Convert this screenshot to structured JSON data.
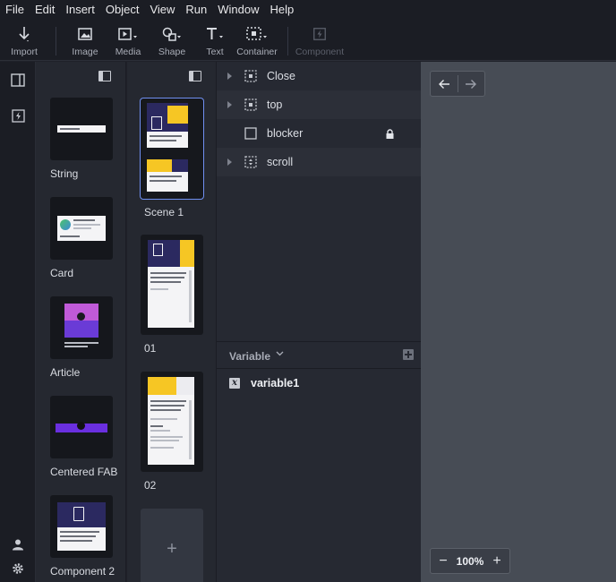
{
  "menu": [
    "File",
    "Edit",
    "Insert",
    "Object",
    "View",
    "Run",
    "Window",
    "Help"
  ],
  "toolbar": {
    "import": "Import",
    "image": "Image",
    "media": "Media",
    "shape": "Shape",
    "text": "Text",
    "container": "Container",
    "component": "Component"
  },
  "components": [
    {
      "name": "String"
    },
    {
      "name": "Card"
    },
    {
      "name": "Article"
    },
    {
      "name": "Centered FAB"
    },
    {
      "name": "Component 2"
    }
  ],
  "scenes": [
    {
      "name": "Scene 1",
      "selected": true
    },
    {
      "name": "01",
      "selected": false
    },
    {
      "name": "02",
      "selected": false
    }
  ],
  "add_scene": "+",
  "layers": [
    {
      "name": "Close",
      "icon": "container-icon",
      "expandable": true
    },
    {
      "name": "top",
      "icon": "container-icon",
      "expandable": true
    },
    {
      "name": "blocker",
      "icon": "rectangle-icon",
      "expandable": false,
      "locked": true
    },
    {
      "name": "scroll",
      "icon": "scroll-container-icon",
      "expandable": true
    }
  ],
  "variables": {
    "title": "Variable",
    "items": [
      {
        "name": "variable1"
      }
    ]
  },
  "canvas": {
    "zoom": "100%",
    "zoom_out": "−",
    "zoom_in": "+"
  },
  "colors": {
    "background": "#1f2129",
    "panel": "#252830",
    "canvas": "#474c55",
    "selection": "#6f8ff0"
  }
}
